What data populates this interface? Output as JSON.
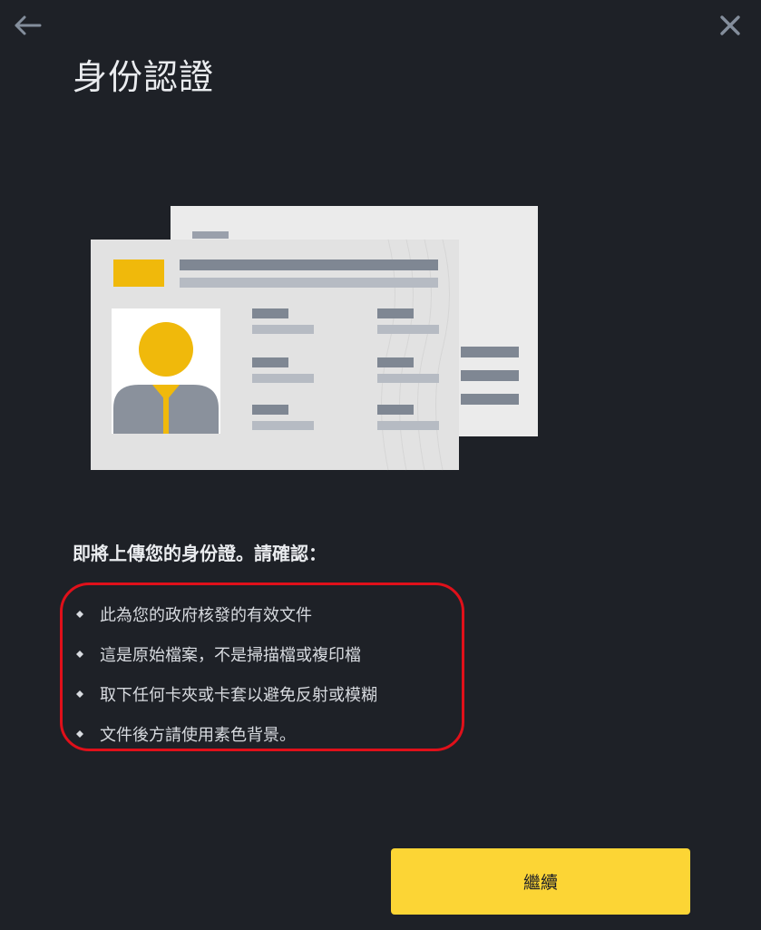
{
  "header": {
    "back_icon": "arrow-left-icon",
    "close_icon": "close-icon"
  },
  "page": {
    "title": "身份認證",
    "prompt": "即將上傳您的身份證。請確認：",
    "checklist": [
      "此為您的政府核發的有效文件",
      "這是原始檔案，不是掃描檔或複印檔",
      "取下任何卡夾或卡套以避免反射或模糊",
      "文件後方請使用素色背景。"
    ],
    "illustration": "id-card-illustration"
  },
  "actions": {
    "continue_label": "繼續"
  },
  "colors": {
    "background": "#1e2127",
    "accent": "#fcd535",
    "highlight_border": "#e0101a",
    "text_primary": "#eaecef"
  }
}
